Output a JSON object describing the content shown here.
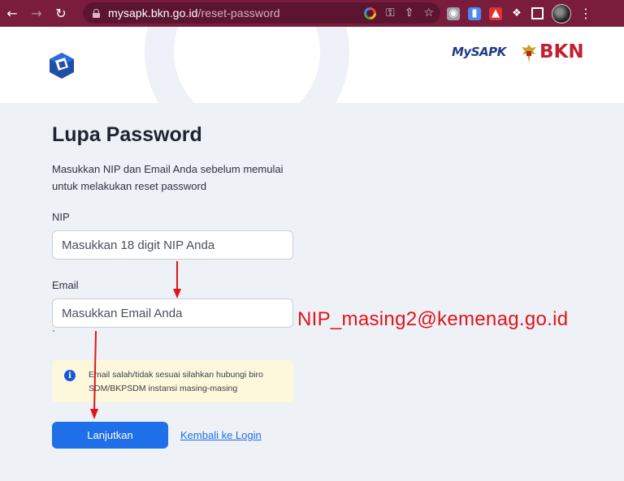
{
  "browser": {
    "url_host": "mysapk.bkn.go.id",
    "url_path": "/reset-password",
    "nav_icons": [
      "back-arrow-icon",
      "forward-arrow-icon",
      "reload-icon"
    ],
    "omnibox_icons": [
      "google-icon",
      "key-icon",
      "share-icon",
      "star-icon"
    ],
    "extension_icons": [
      "camera-icon",
      "extension-icon",
      "bookmark-icon",
      "puzzle-icon",
      "sidebar-icon",
      "avatar",
      "menu-icon"
    ],
    "chrome_color": "#7a1d3c"
  },
  "header": {
    "brand_mysapk": "MySAPK",
    "brand_bkn": "BKN"
  },
  "form": {
    "title": "Lupa Password",
    "description": "Masukkan NIP dan Email Anda sebelum memulai untuk melakukan reset password",
    "nip_label": "NIP",
    "nip_placeholder": "Masukkan 18 digit NIP Anda",
    "email_label": "Email",
    "email_placeholder": "Masukkan Email Anda",
    "stray_mark": "`",
    "alert_text": "Email salah/tidak sesuai silahkan hubungi biro SDM/BKPSDM instansi masing-masing",
    "submit_label": "Lanjutkan",
    "back_link": "Kembali ke Login"
  },
  "annotation": {
    "email_example": "NIP_masing2@kemenag.go.id",
    "color": "#e0141a"
  },
  "colors": {
    "primary": "#1f6fe8",
    "alert_bg": "#fdf8dc",
    "page_bg": "#eef1f6"
  }
}
